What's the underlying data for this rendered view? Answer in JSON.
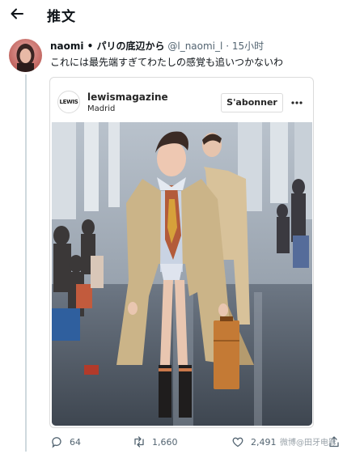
{
  "topbar": {
    "title": "推文",
    "back_icon": "arrow-left-icon"
  },
  "tweet": {
    "display_name": "naomi • パリの底辺から",
    "handle": "@l_naomi_l",
    "separator": "·",
    "time": "15小时",
    "text": "これには最先端すぎてわたしの感覚も追いつかないわ"
  },
  "embed": {
    "logo_text": "LEWIS",
    "username": "lewismagazine",
    "location": "Madrid",
    "follow_label": "S'abonner",
    "more_icon": "more-horizontal-icon"
  },
  "actions": {
    "reply_count": "64",
    "retweet_count": "1,660",
    "like_count": "2,491",
    "reply_icon": "comment-icon",
    "retweet_icon": "retweet-icon",
    "like_icon": "heart-icon",
    "share_icon": "share-icon"
  },
  "watermark": "微博@田牙电影"
}
